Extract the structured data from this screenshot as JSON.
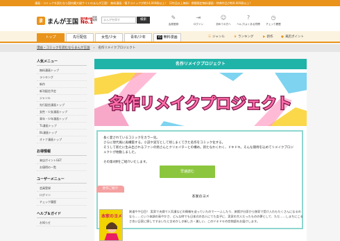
{
  "topbar": {
    "text": "漫画・コミックを読むなら国内最大級サイトのまんが王国！ 無料漫画・電子コミックが約14,000冊以上！（2作品以上無料）期間限定無料漫画・特典作品が約9,000冊以上！"
  },
  "header": {
    "logo_mark": "ま",
    "logo_text": "まんが王国",
    "badge_small": "国内最大級",
    "badge_big": "No.1",
    "sub_badge": [
      "調査",
      "機関"
    ],
    "search_placeholder": "まんがを探す",
    "search_button": "検索",
    "icons": [
      {
        "icon": "member-icon",
        "label": "会員登録"
      },
      {
        "icon": "login-icon",
        "label": "ログイン"
      },
      {
        "icon": "first-time-icon",
        "label": "初めての方へ"
      },
      {
        "icon": "help-icon",
        "label": "ヘルプ/よくある質問"
      },
      {
        "icon": "history-icon",
        "label": "チェック履歴"
      }
    ]
  },
  "nav": {
    "tabs": [
      {
        "label": "トップ"
      },
      {
        "label": "先行配信"
      },
      {
        "label": "女性/少女"
      },
      {
        "label": "青年/少年"
      },
      {
        "label": "無料漫画",
        "prefix": "YO"
      }
    ],
    "right": [
      {
        "icon": "genre-icon",
        "label": "ジャンル"
      },
      {
        "icon": "ranking-icon",
        "label": "ランキング"
      },
      {
        "icon": "new-icon",
        "label": "新作"
      },
      {
        "icon": "points-icon",
        "label": "来店ポイント"
      }
    ]
  },
  "breadcrumb": {
    "home": "漫画・コミックを読むならまんが王国",
    "current": "名作リメイクプロジェクト"
  },
  "sidebar": {
    "sections": [
      {
        "title": "人気メニュー",
        "items": [
          "無料漫画トップ",
          "ランキング",
          "新作",
          "新刊配信予定",
          "ジャンル",
          "先行配信漫画トップ",
          "女性・少女漫画トップ",
          "青年・少年漫画トップ",
          "TL漫画トップ",
          "BL漫画トップ",
          "オトナ漫画トップ"
        ]
      },
      {
        "title": "お得情報",
        "items": [
          "来店ポイントGET",
          "お値得の一覧"
        ]
      },
      {
        "title": "ユーザーメニュー",
        "items": [
          "会員登録",
          "ログイン",
          "チェック履歴"
        ]
      },
      {
        "title": "ヘルプ＆ガイド",
        "items": [
          "お知らせ"
        ]
      }
    ]
  },
  "main": {
    "title": "名作リメイクプロジェクト",
    "banner_text": "名作リメイクプロジェクト",
    "intro": [
      "長く愛されているコミックをカラー化。",
      "さらに現代風に再構築する。小説や実写として残しまくてきた名作をコミック化する。",
      "そうして新たに生み出されるファンの熱さんとクリエイターとの構め。新たなわくわく、ドキドキ。そんな期待を込めてリメイクプロジェクトが始動しました。",
      "",
      "その第4弾をご紹介いたします。"
    ],
    "button": "早速読む",
    "original_label": "原作ご紹介",
    "original_title": "本家のヨメ",
    "original_desc": "剣道やや日目！ 実家で夫婦で人気漫などの情報を送っていたのでーーふしたり、旅館が分家から移家で受け入れもたくさんになるのなら……という体調の高やかさ、どんな時でも日本式の恋人にてた女子に、実家の大人だったものの夢として、ただ……しまちにこるさ合い日家に嫁しですまいたと古めかしき新し方・美しい、このドキドキの恋物語をお届けします。",
    "cover_title": "本家のヨメ"
  },
  "colors": {
    "orange": "#e9931a",
    "teal": "#20b3a8",
    "green": "#8cc63f",
    "pink": "#f5a0a0"
  }
}
